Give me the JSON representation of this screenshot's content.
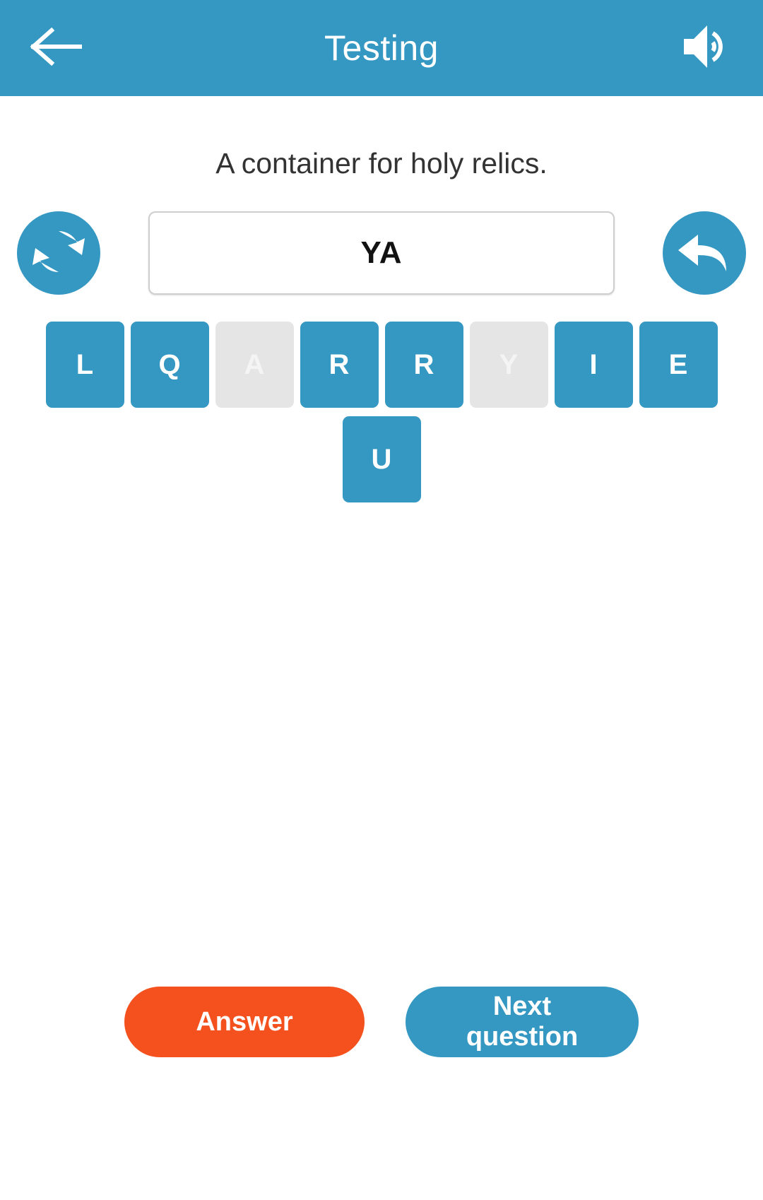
{
  "header": {
    "title": "Testing",
    "back_icon": "arrow-left-icon",
    "sound_icon": "speaker-volume-icon",
    "background_color": "#3498c2"
  },
  "question": {
    "text": "A container for holy relics."
  },
  "answer_area": {
    "shuffle_icon": "refresh-shuffle-icon",
    "undo_icon": "undo-arrow-icon",
    "value": "YA",
    "placeholder": ""
  },
  "letters": {
    "rows": [
      [
        {
          "char": "L",
          "used": false
        },
        {
          "char": "Q",
          "used": false
        },
        {
          "char": "A",
          "used": true
        },
        {
          "char": "R",
          "used": false
        },
        {
          "char": "R",
          "used": false
        },
        {
          "char": "Y",
          "used": true
        },
        {
          "char": "I",
          "used": false
        },
        {
          "char": "E",
          "used": false
        }
      ],
      [
        {
          "char": "U",
          "used": false
        }
      ]
    ],
    "tile_color": "#3498c2",
    "tile_used_color": "#e5e5e5"
  },
  "actions": {
    "answer_label": "Answer",
    "answer_color": "#f4511e",
    "next_label": "Next question",
    "next_color": "#3498c2"
  }
}
